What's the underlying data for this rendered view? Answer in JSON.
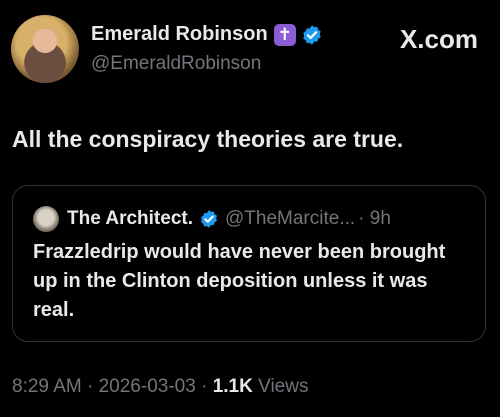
{
  "post": {
    "author_name": "Emerald Robinson",
    "author_handle": "@EmeraldRobinson",
    "badge_icon": "cross-badge-icon",
    "verified_icon": "verified-check-icon",
    "platform_label": "X.com",
    "text": "All the conspiracy theories are true."
  },
  "quoted": {
    "author_name": "The Architect.",
    "author_handle": "@TheMarcite...",
    "time": "· 9h",
    "text": "Frazzledrip would have never been brought up in the Clinton deposition unless it was real."
  },
  "meta": {
    "time": "8:29 AM",
    "sep1": " · ",
    "date": "2026-03-03",
    "sep2": " · ",
    "views_count": "1.1K",
    "views_label": " Views"
  },
  "colors": {
    "background": "#000000",
    "text": "#e7e9ea",
    "muted": "#71767b",
    "verified_blue": "#1d9bf0",
    "badge_purple": "#8a5cd6",
    "border": "#2f3336"
  }
}
